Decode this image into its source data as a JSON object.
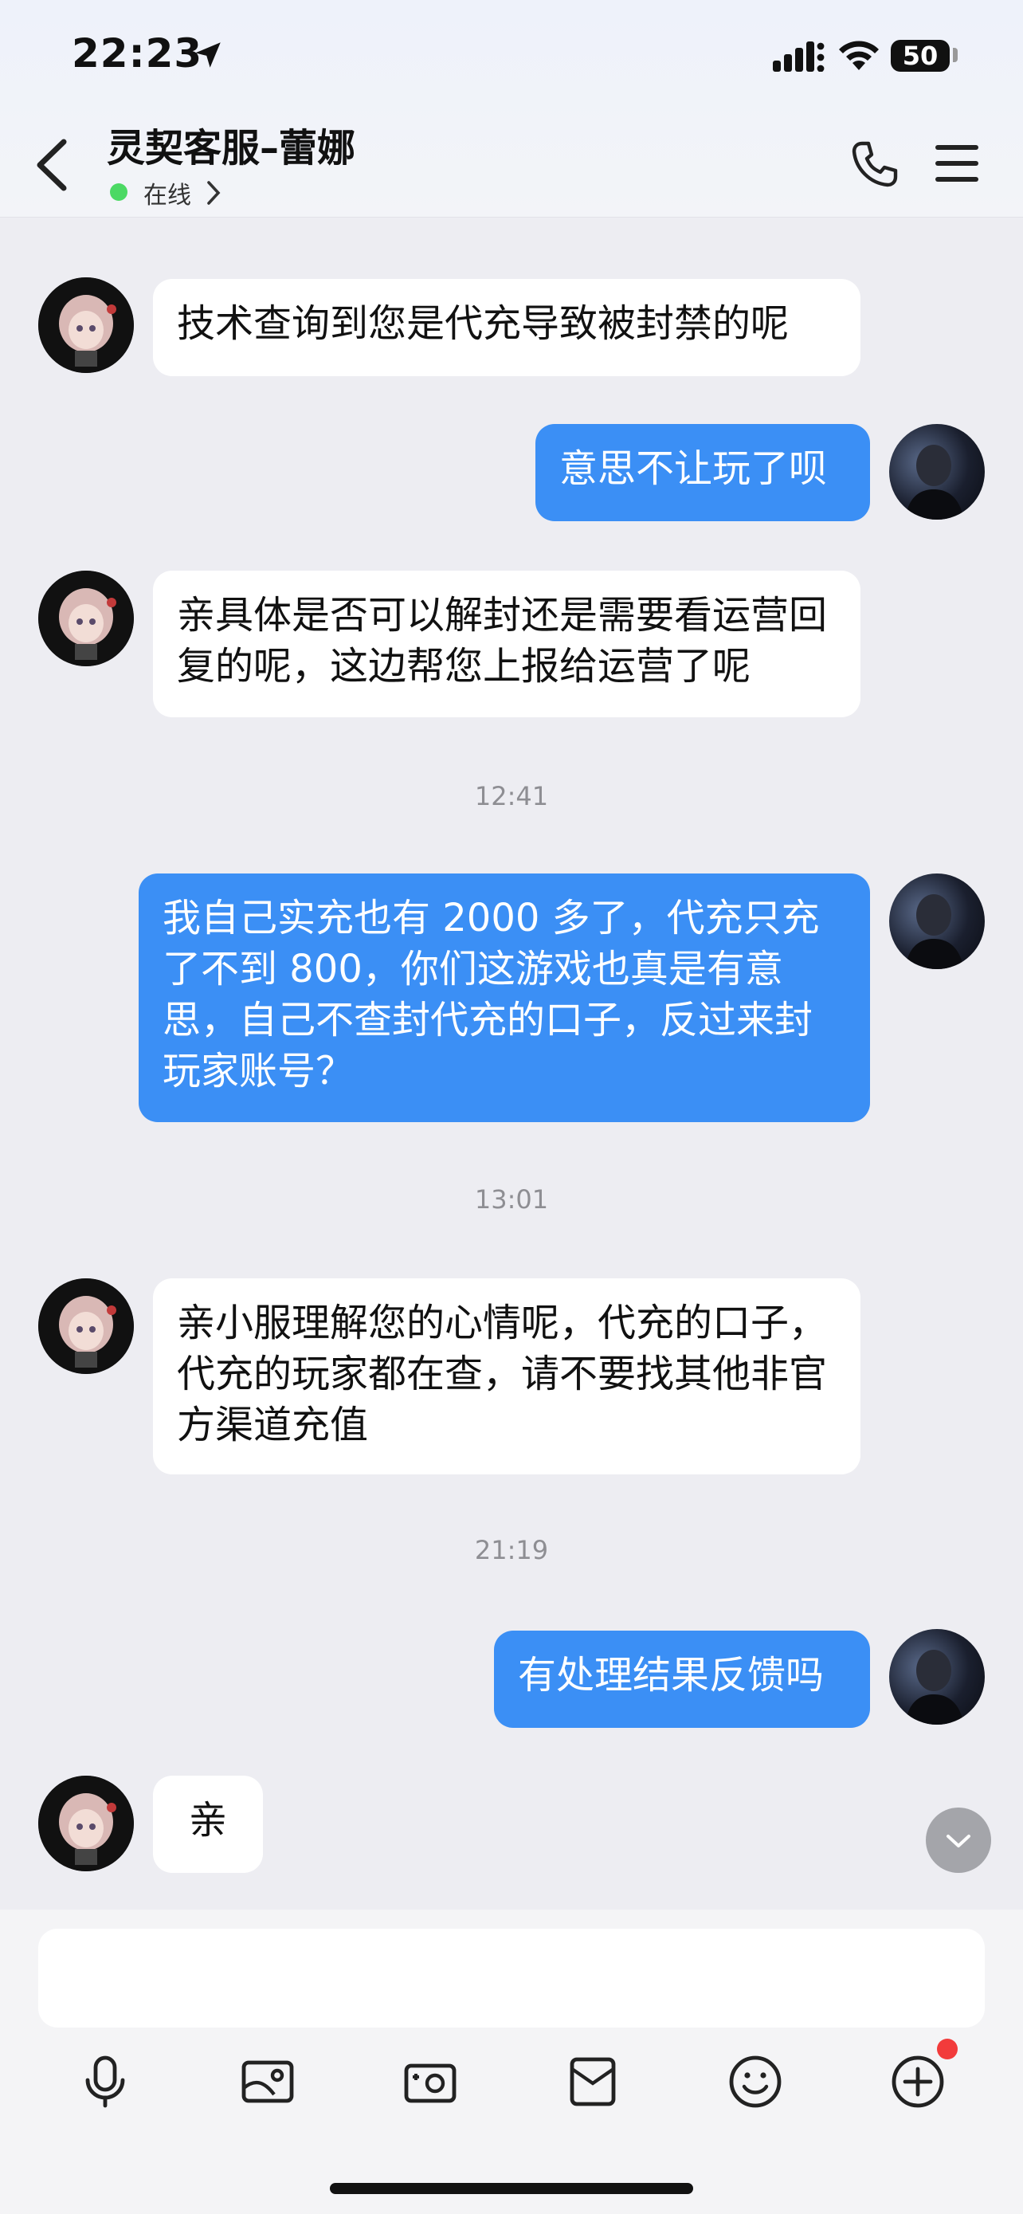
{
  "status_bar": {
    "time": "22:23",
    "battery": "50"
  },
  "header": {
    "title": "灵契客服–蕾娜",
    "status": "在线"
  },
  "messages": [
    {
      "sender": "agent",
      "text": "技术查询到您是代充导致被封禁的呢"
    },
    {
      "sender": "user",
      "text": "意思不让玩了呗"
    },
    {
      "sender": "agent",
      "text": "亲具体是否可以解封还是需要看运营回复的呢，这边帮您上报给运营了呢"
    },
    {
      "sender": "time",
      "text": "12:41"
    },
    {
      "sender": "user",
      "text": "我自己实充也有 2000 多了，代充只充了不到 800，你们这游戏也真是有意思，自己不查封代充的口子，反过来封玩家账号？"
    },
    {
      "sender": "time",
      "text": "13:01"
    },
    {
      "sender": "agent",
      "text": "亲小服理解您的心情呢，代充的口子，代充的玩家都在查，请不要找其他非官方渠道充值"
    },
    {
      "sender": "time",
      "text": "21:19"
    },
    {
      "sender": "user",
      "text": "有处理结果反馈吗"
    },
    {
      "sender": "agent",
      "text": "亲"
    }
  ],
  "composer": {
    "input_value": "",
    "tools": [
      "microphone-icon",
      "image-icon",
      "camera-icon",
      "mailbox-icon",
      "emoji-icon",
      "plus-icon"
    ]
  },
  "colors": {
    "user_bubble": "#3B8FF5",
    "agent_bubble": "#FFFFFF",
    "background": "#EDEDF2",
    "online": "#4CD964",
    "badge": "#F23B3B"
  }
}
